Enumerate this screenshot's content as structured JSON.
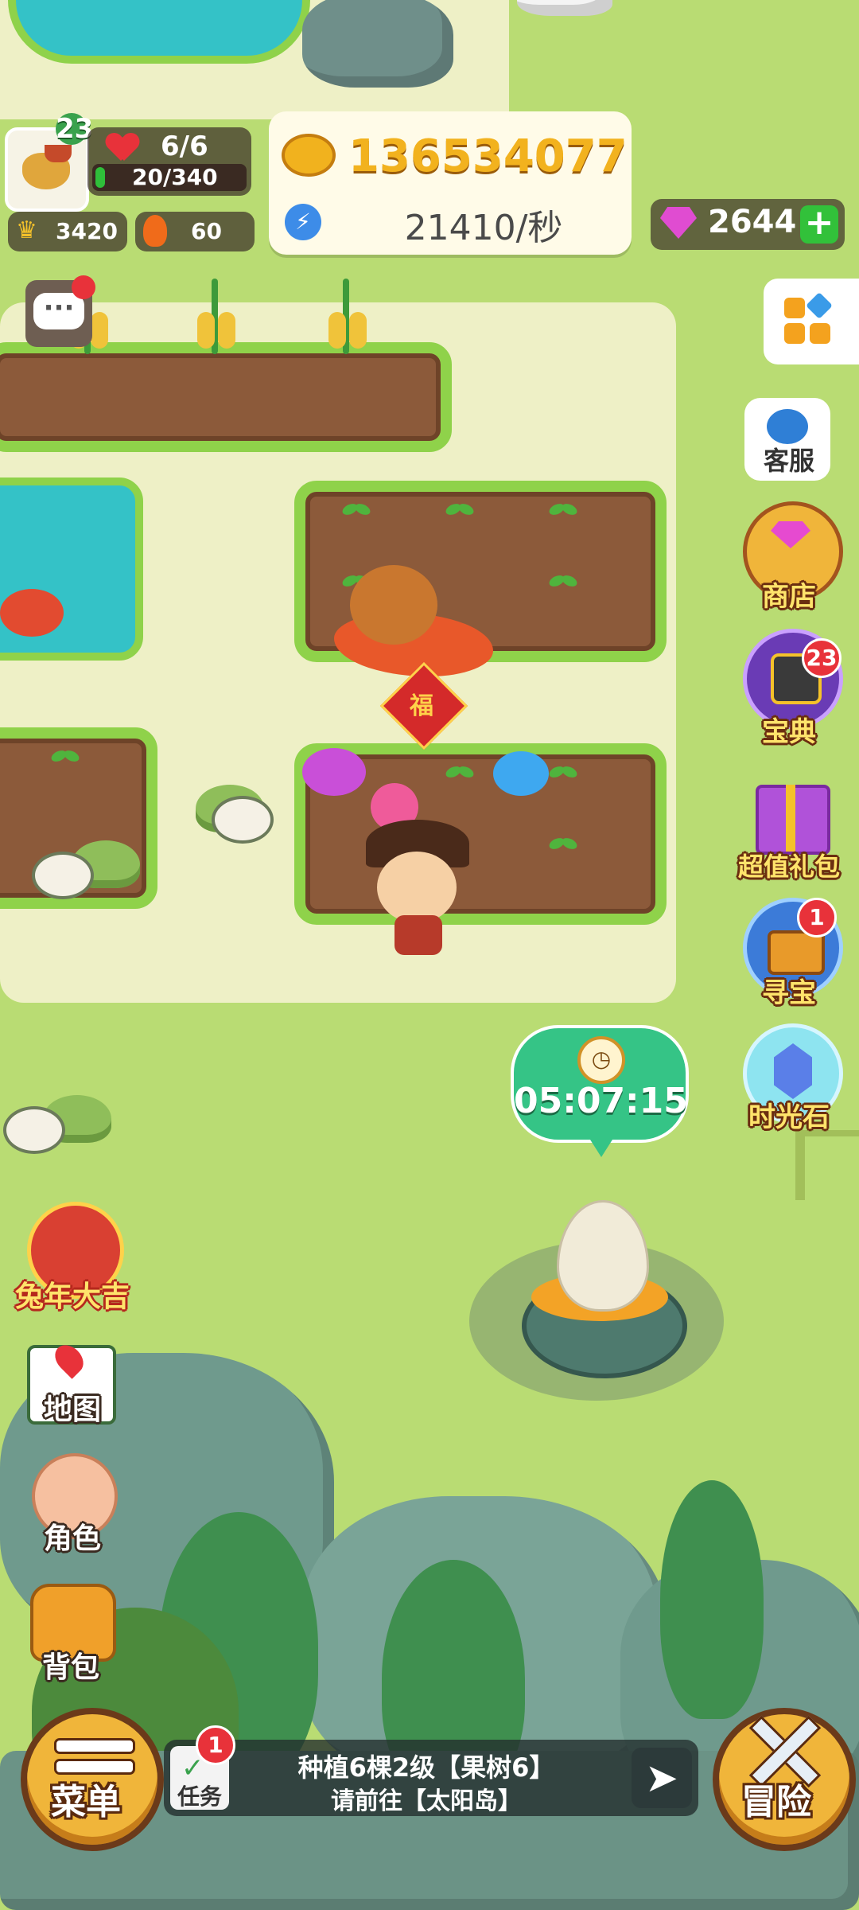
{
  "player": {
    "level": "23",
    "hp": "6/6",
    "exp": "20/340",
    "crowns": "3420",
    "fire": "60"
  },
  "currency": {
    "gold": "136534077",
    "rate": "21410/秒",
    "gems": "2644"
  },
  "side_buttons": [
    {
      "label": "客服",
      "icon": "headset-icon"
    },
    {
      "label": "商店",
      "icon": "treasure-chest-icon"
    },
    {
      "label": "宝典",
      "icon": "codex-icon",
      "badge": "23"
    },
    {
      "label": "超值礼包",
      "icon": "gift-box-icon"
    },
    {
      "label": "寻宝",
      "icon": "treasure-hunt-icon",
      "badge": "1"
    },
    {
      "label": "时光石",
      "icon": "time-stone-icon"
    }
  ],
  "left_buttons": [
    {
      "label": "兔年大吉",
      "icon": "rabbit-year-icon"
    },
    {
      "label": "地图",
      "icon": "map-icon"
    },
    {
      "label": "角色",
      "icon": "character-icon"
    },
    {
      "label": "背包",
      "icon": "backpack-icon"
    }
  ],
  "egg_timer": "05:07:15",
  "fortune_tag": "福",
  "bottom": {
    "menu_label": "菜单",
    "adventure_label": "冒险",
    "task_label": "任务",
    "task_badge": "1",
    "task_line1": "种植6棵2级【果树6】",
    "task_line2": "请前往【太阳岛】"
  },
  "colors": {
    "grass": "#b9dc73",
    "path": "#eef0c6",
    "soil": "#8c5a3a",
    "pond": "#34c2c7",
    "label_yellow": "#ffe46b",
    "badge_red": "#e8323a"
  }
}
